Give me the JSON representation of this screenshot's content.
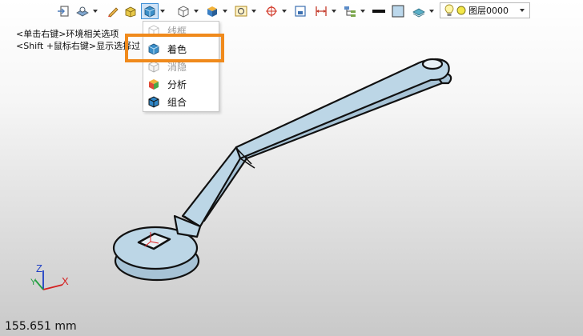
{
  "hints": {
    "line1": "<单击右键>环境相关选项",
    "line2": "<Shift +鼠标右键>显示选择过"
  },
  "display_menu": {
    "items": [
      {
        "label": "线框",
        "icon": "wireframe-cube-icon"
      },
      {
        "label": "着色",
        "icon": "shaded-cube-icon"
      },
      {
        "label": "消隐",
        "icon": "hidden-line-cube-icon"
      },
      {
        "label": "分析",
        "icon": "analysis-cube-icon"
      },
      {
        "label": "组合",
        "icon": "combined-cube-icon"
      }
    ],
    "highlighted": "着色"
  },
  "layer": {
    "name": "图层0000",
    "icons": [
      "lightbulb-icon",
      "layer-color-dot-icon"
    ]
  },
  "colors": {
    "highlight": "#f08a1c",
    "active_button_bg": "#cfe3f7",
    "part_fill": "#bcd6e6"
  },
  "axes": {
    "x": "X",
    "y": "Y",
    "z": "Z"
  },
  "status": {
    "measurement": "155.651 mm"
  }
}
